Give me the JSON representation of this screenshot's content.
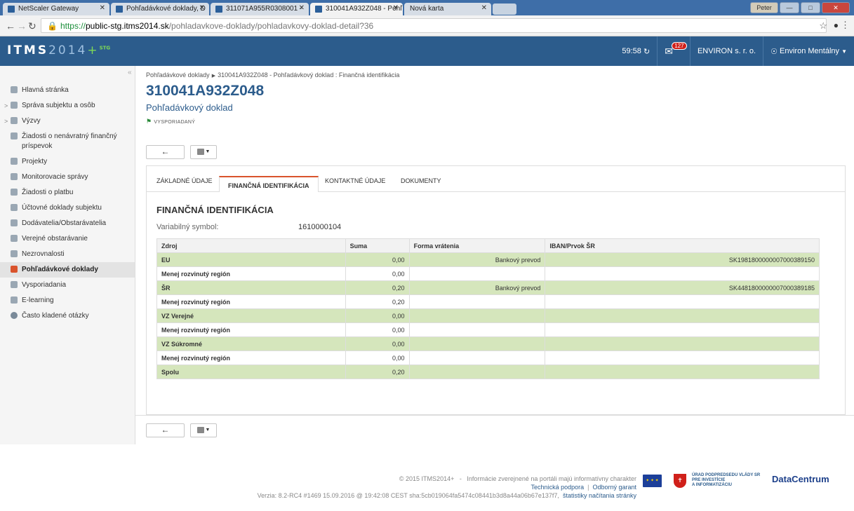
{
  "browser": {
    "tabs": [
      {
        "title": "NetScaler Gateway"
      },
      {
        "title": "Pohľadávkové doklady, D"
      },
      {
        "title": "311071A955R0308001 -"
      },
      {
        "title": "310041A932Z048 - Pohľ"
      },
      {
        "title": "Nová karta"
      }
    ],
    "url_scheme": "https://",
    "url_host": "public-stg.itms2014.sk",
    "url_path": "/pohladavkove-doklady/pohladavkovy-doklad-detail?36",
    "user_button": "Peter"
  },
  "navbar": {
    "logo_letters": "ITMS",
    "logo_numbers": "2014",
    "logo_plus": "+",
    "logo_env": "STG",
    "timer": "59:58",
    "messages_count": "127",
    "organization": "ENVIRON s. r. o.",
    "user": "Environ Mentálny"
  },
  "sidebar": {
    "items": [
      {
        "label": "Hlavná stránka",
        "icon": "home-icon"
      },
      {
        "label": "Správa subjektu a osôb",
        "icon": "users-icon"
      },
      {
        "label": "Výzvy",
        "icon": "megaphone-icon"
      },
      {
        "label": "Žiadosti o nenávratný finančný príspevok",
        "icon": "document-icon"
      },
      {
        "label": "Projekty",
        "icon": "folder-icon"
      },
      {
        "label": "Monitorovacie správy",
        "icon": "report-icon"
      },
      {
        "label": "Žiadosti o platbu",
        "icon": "payment-icon"
      },
      {
        "label": "Účtovné doklady subjektu",
        "icon": "ledger-icon"
      },
      {
        "label": "Dodávatelia/Obstarávatelia",
        "icon": "supplier-icon"
      },
      {
        "label": "Verejné obstarávanie",
        "icon": "procurement-icon"
      },
      {
        "label": "Nezrovnalosti",
        "icon": "not-equal-icon"
      },
      {
        "label": "Pohľadávkové doklady",
        "icon": "receivable-icon"
      },
      {
        "label": "Vysporiadania",
        "icon": "settlement-icon"
      },
      {
        "label": "E-learning",
        "icon": "book-icon"
      },
      {
        "label": "Často kladené otázky",
        "icon": "help-icon"
      }
    ]
  },
  "page": {
    "breadcrumb_parent": "Pohľadávkové doklady",
    "breadcrumb_current": "310041A932Z048 - Pohľadávkový doklad : Finančná identifikácia",
    "title": "310041A932Z048",
    "subtitle": "Pohľadávkový doklad",
    "status": "VYSPORIADANÝ",
    "back_symbol": "←"
  },
  "tabs": [
    {
      "label": "ZÁKLADNÉ ÚDAJE"
    },
    {
      "label": "FINANČNÁ IDENTIFIKÁCIA"
    },
    {
      "label": "KONTAKTNÉ ÚDAJE"
    },
    {
      "label": "DOKUMENTY"
    }
  ],
  "section": {
    "title": "FINANČNÁ IDENTIFIKÁCIA",
    "vs_label": "Variabilný symbol:",
    "vs_value": "1610000104"
  },
  "table": {
    "headers": [
      "Zdroj",
      "Suma",
      "Forma vrátenia",
      "IBAN/Prvok ŠR"
    ],
    "rows": [
      {
        "zdroj": "EU",
        "suma": "0,00",
        "forma": "Bankový prevod",
        "iban": "SK1981800000007000389150"
      },
      {
        "zdroj": "Menej rozvinutý región",
        "suma": "0,00",
        "forma": "",
        "iban": ""
      },
      {
        "zdroj": "ŠR",
        "suma": "0,20",
        "forma": "Bankový prevod",
        "iban": "SK4481800000007000389185"
      },
      {
        "zdroj": "Menej rozvinutý región",
        "suma": "0,20",
        "forma": "",
        "iban": ""
      },
      {
        "zdroj": "VZ Verejné",
        "suma": "0,00",
        "forma": "",
        "iban": ""
      },
      {
        "zdroj": "Menej rozvinutý región",
        "suma": "0,00",
        "forma": "",
        "iban": ""
      },
      {
        "zdroj": "VZ Súkromné",
        "suma": "0,00",
        "forma": "",
        "iban": ""
      },
      {
        "zdroj": "Menej rozvinutý región",
        "suma": "0,00",
        "forma": "",
        "iban": ""
      },
      {
        "zdroj": "Spolu",
        "suma": "0,20",
        "forma": "",
        "iban": ""
      }
    ]
  },
  "footer": {
    "copyright": "© 2015 ITMS2014+",
    "dash": "-",
    "info": "Informácie zverejnené na portáli majú informatívny charakter",
    "support": "Technická podpora",
    "pipe": "|",
    "guarantor": "Odborný garant",
    "version": "Verzia: 8.2-RC4 #1469 15.09.2016 @ 19:42:08 CEST sha:5cb019064fa5474c08441b3d8a44a06b67e137f7,",
    "stats": "štatistiky načítania stránky",
    "urad_line1": "ÚRAD PODPREDSEDU VLÁDY SR",
    "urad_line2": "PRE INVESTÍCIE",
    "urad_line3": "A INFORMATIZÁCIU",
    "datacentrum": "DataCentrum"
  }
}
